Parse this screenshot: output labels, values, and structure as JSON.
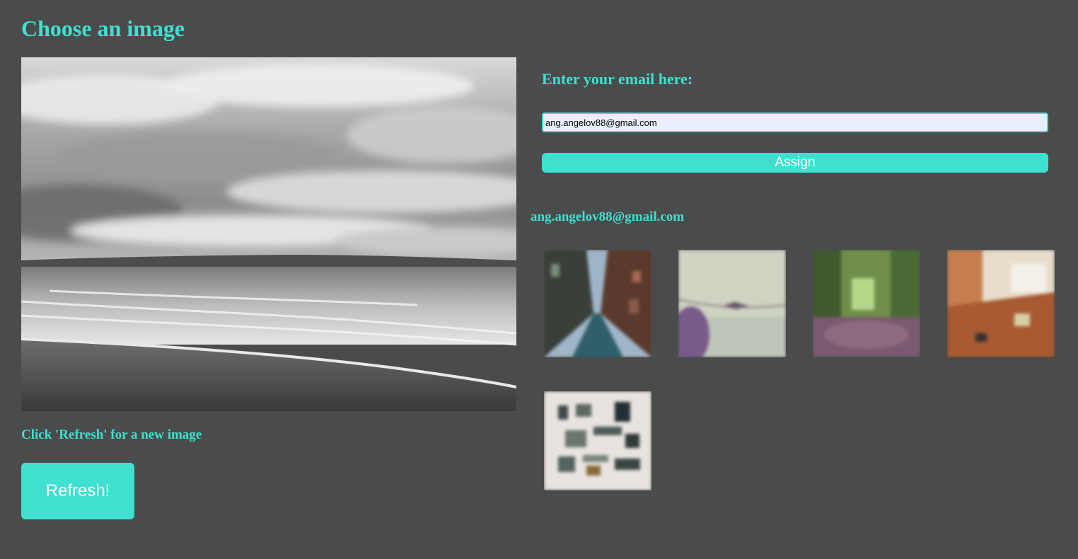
{
  "header": {
    "title": "Choose an image"
  },
  "main_image": {
    "icon": "beach-photo",
    "description_role": "grayscale seascape"
  },
  "left": {
    "hint": "Click 'Refresh' for a new image",
    "refresh_label": "Refresh!"
  },
  "form": {
    "label": "Enter your email here:",
    "email_value": "ang.angelov88@gmail.com",
    "assign_label": "Assign"
  },
  "assigned": {
    "email": "ang.angelov88@gmail.com",
    "thumbnails": [
      {
        "icon": "city-street-photo"
      },
      {
        "icon": "bird-sky-photo"
      },
      {
        "icon": "forest-path-photo"
      },
      {
        "icon": "cafe-table-photo"
      },
      {
        "icon": "flatlay-items-photo"
      }
    ]
  },
  "colors": {
    "accent": "#3fe0d0",
    "background": "#4a4b4b",
    "input_background": "#e8f0fe"
  }
}
